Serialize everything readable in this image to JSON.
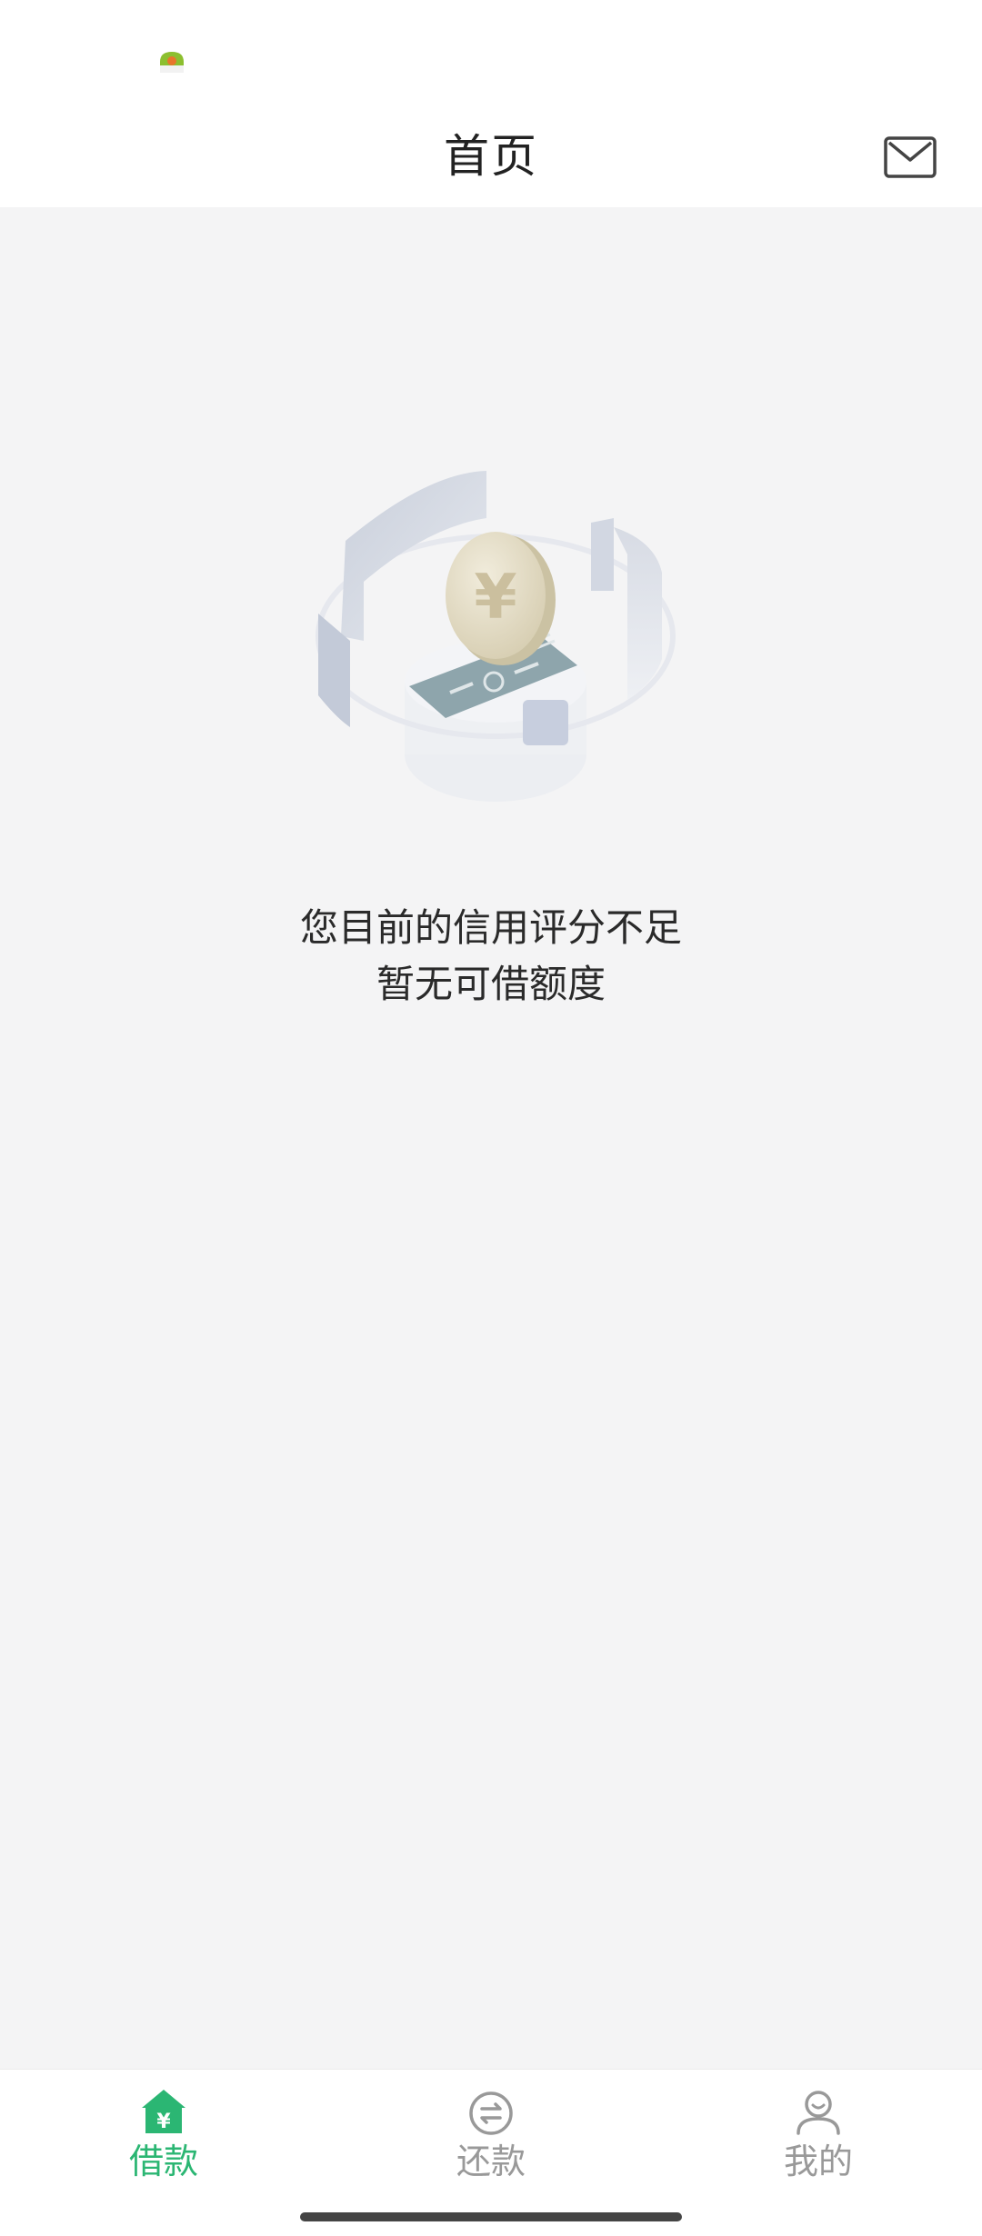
{
  "header": {
    "title": "首页"
  },
  "empty_state": {
    "line1": "您目前的信用评分不足",
    "line2": "暂无可借额度"
  },
  "tabbar": {
    "items": [
      {
        "label": "借款",
        "icon": "loan-house-icon",
        "active": true
      },
      {
        "label": "还款",
        "icon": "repay-exchange-icon",
        "active": false
      },
      {
        "label": "我的",
        "icon": "profile-icon",
        "active": false
      }
    ]
  },
  "colors": {
    "accent": "#2bb673",
    "inactive": "#999999",
    "background": "#f4f4f5"
  }
}
